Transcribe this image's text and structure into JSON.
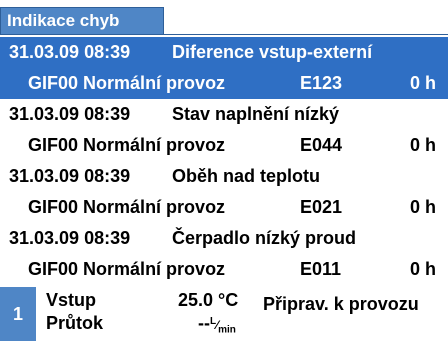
{
  "title": "Indikace chyb",
  "colors": {
    "accent": "#4f86c6",
    "selection": "#2f6fc4",
    "background": "#ffffff"
  },
  "entries": [
    {
      "datetime": "31.03.09 08:39",
      "message": "Diference vstup-externí",
      "device": "GIF00",
      "mode": "Normální provoz",
      "code": "E123",
      "duration": "0 h",
      "selected": true
    },
    {
      "datetime": "31.03.09 08:39",
      "message": "Stav naplnění nízký",
      "device": "GIF00",
      "mode": "Normální provoz",
      "code": "E044",
      "duration": "0 h",
      "selected": false
    },
    {
      "datetime": "31.03.09 08:39",
      "message": "Oběh nad teplotu",
      "device": "GIF00",
      "mode": "Normální provoz",
      "code": "E021",
      "duration": "0 h",
      "selected": false
    },
    {
      "datetime": "31.03.09 08:39",
      "message": "Čerpadlo nízký proud",
      "device": "GIF00",
      "mode": "Normální provoz",
      "code": "E011",
      "duration": "0 h",
      "selected": false
    }
  ],
  "status": {
    "channel": "1",
    "input_label": "Vstup",
    "input_value": "25.0 °C",
    "flow_label": "Průtok",
    "flow_value": "--",
    "flow_unit_top": "L",
    "flow_unit_bottom": "min",
    "state": "Připrav. k provozu"
  }
}
